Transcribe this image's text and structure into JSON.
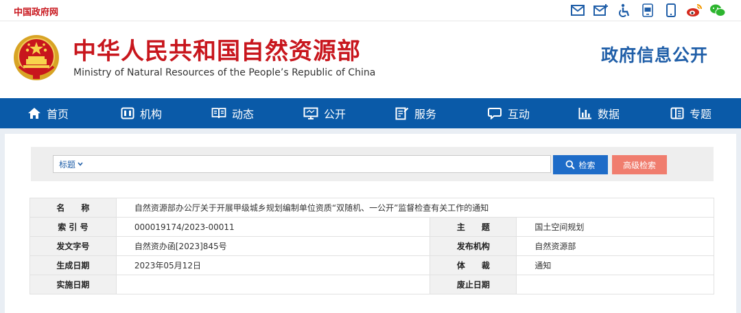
{
  "topbar": {
    "gov_link": "中国政府网",
    "icons": [
      "mail-icon",
      "mail-plus-icon",
      "accessibility-icon",
      "app-icon",
      "mobile-icon",
      "weibo-icon",
      "wechat-icon"
    ]
  },
  "header": {
    "title_cn": "中华人民共和国自然资源部",
    "title_en": "Ministry of Natural Resources of the People’s Republic of China",
    "disclosure": "政府信息公开"
  },
  "nav": {
    "items": [
      {
        "label": "首页",
        "icon": "home-icon"
      },
      {
        "label": "机构",
        "icon": "org-icon"
      },
      {
        "label": "动态",
        "icon": "book-icon"
      },
      {
        "label": "公开",
        "icon": "monitor-icon"
      },
      {
        "label": "服务",
        "icon": "document-edit-icon"
      },
      {
        "label": "互动",
        "icon": "chat-icon"
      },
      {
        "label": "数据",
        "icon": "bar-chart-icon"
      },
      {
        "label": "专题",
        "icon": "booklet-icon"
      }
    ]
  },
  "search": {
    "field_selector": "标题",
    "value": "",
    "search_label": "检索",
    "advanced_label": "高级检索"
  },
  "info": {
    "name_label": "名　　称",
    "name_value": "自然资源部办公厅关于开展甲级城乡规划编制单位资质“双随机、一公开”监督检查有关工作的通知",
    "index_label": "索 引 号",
    "index_value": "000019174/2023-00011",
    "topic_label": "主　　题",
    "topic_value": "国土空间规划",
    "doc_no_label": "发文字号",
    "doc_no_value": "自然资办函[2023]845号",
    "issuer_label": "发布机构",
    "issuer_value": "自然资源部",
    "date_label": "生成日期",
    "date_value": "2023年05月12日",
    "genre_label": "体　　裁",
    "genre_value": "通知",
    "effective_label": "实施日期",
    "effective_value": "",
    "expiry_label": "废止日期",
    "expiry_value": ""
  },
  "colors": {
    "brand_red": "#c8161d",
    "nav_blue": "#0a5aa8",
    "title_blue": "#1f5ea8",
    "search_blue": "#1e6cc8",
    "advanced_orange": "#f07d6e"
  }
}
